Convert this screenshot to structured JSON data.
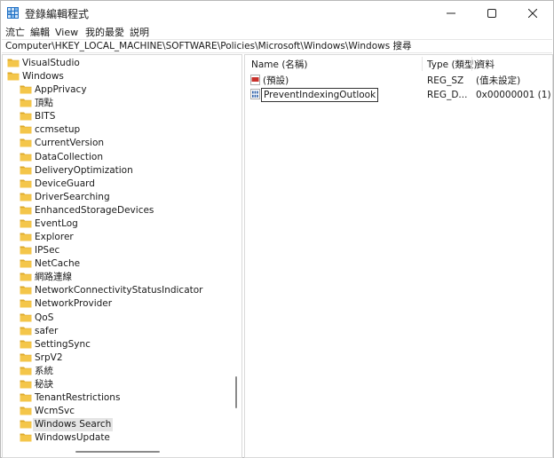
{
  "window": {
    "title": "登錄編輯程式",
    "controls": {
      "minimize": "—",
      "maximize": "☐",
      "close": "✕"
    }
  },
  "menu": [
    "流亡",
    "編輯",
    "View",
    "我的最愛",
    "説明"
  ],
  "address": "Computer\\HKEY_LOCAL_MACHINE\\SOFTWARE\\Policies\\Microsoft\\Windows\\Windows 搜尋",
  "tree": [
    {
      "label": "VisualStudio",
      "level": 0,
      "expandable": false
    },
    {
      "label": "Windows",
      "level": 0,
      "expandable": false
    },
    {
      "label": "AppPrivacy",
      "level": 1,
      "expandable": false
    },
    {
      "label": "頂點",
      "level": 1,
      "expandable": false
    },
    {
      "label": "BITS",
      "level": 1,
      "expandable": false
    },
    {
      "label": "ccmsetup",
      "level": 1,
      "expandable": false
    },
    {
      "label": "CurrentVersion",
      "level": 1,
      "expandable": true
    },
    {
      "label": "DataCollection",
      "level": 1,
      "expandable": false
    },
    {
      "label": "DeliveryOptimization",
      "level": 1,
      "expandable": false
    },
    {
      "label": "DeviceGuard",
      "level": 1,
      "expandable": false
    },
    {
      "label": "DriverSearching",
      "level": 1,
      "expandable": false
    },
    {
      "label": "EnhancedStorageDevices",
      "level": 1,
      "expandable": false
    },
    {
      "label": "EventLog",
      "level": 1,
      "expandable": true
    },
    {
      "label": "Explorer",
      "level": 1,
      "expandable": false
    },
    {
      "label": "IPSec",
      "level": 1,
      "expandable": true
    },
    {
      "label": "NetCache",
      "level": 1,
      "expandable": false
    },
    {
      "label": "網路連線",
      "level": 1,
      "expandable": false
    },
    {
      "label": "NetworkConnectivityStatusIndicator",
      "level": 1,
      "expandable": false
    },
    {
      "label": "NetworkProvider",
      "level": 1,
      "expandable": true
    },
    {
      "label": "QoS",
      "level": 1,
      "expandable": true
    },
    {
      "label": "safer",
      "level": 1,
      "expandable": true
    },
    {
      "label": "SettingSync",
      "level": 1,
      "expandable": false
    },
    {
      "label": "SrpV2",
      "level": 1,
      "expandable": true
    },
    {
      "label": "系統",
      "level": 1,
      "expandable": true
    },
    {
      "label": "秘訣",
      "level": 1,
      "expandable": true
    },
    {
      "label": "TenantRestrictions",
      "level": 1,
      "expandable": true
    },
    {
      "label": "WcmSvc",
      "level": 1,
      "expandable": true
    },
    {
      "label": "Windows Search",
      "level": 1,
      "expandable": false,
      "selected": true
    },
    {
      "label": "WindowsUpdate",
      "level": 1,
      "expandable": true
    }
  ],
  "list": {
    "headers": {
      "name": "Name (名稱)",
      "type": "Type (類型)",
      "data": "資料"
    },
    "rows": [
      {
        "icon": "string-value-icon",
        "name": "(預設)",
        "type": "REG_SZ",
        "data": "(值未設定)",
        "editing": false
      },
      {
        "icon": "dword-value-icon",
        "name": "PreventIndexingOutlook",
        "type": "REG_D...",
        "data": "0x00000001 (1)",
        "editing": true
      }
    ]
  },
  "colors": {
    "folder": "#f4c64a",
    "folder_dark": "#dca829",
    "selection": "#e5e5e5",
    "icon_red": "#c8322c",
    "icon_blue": "#2b5fa8"
  }
}
